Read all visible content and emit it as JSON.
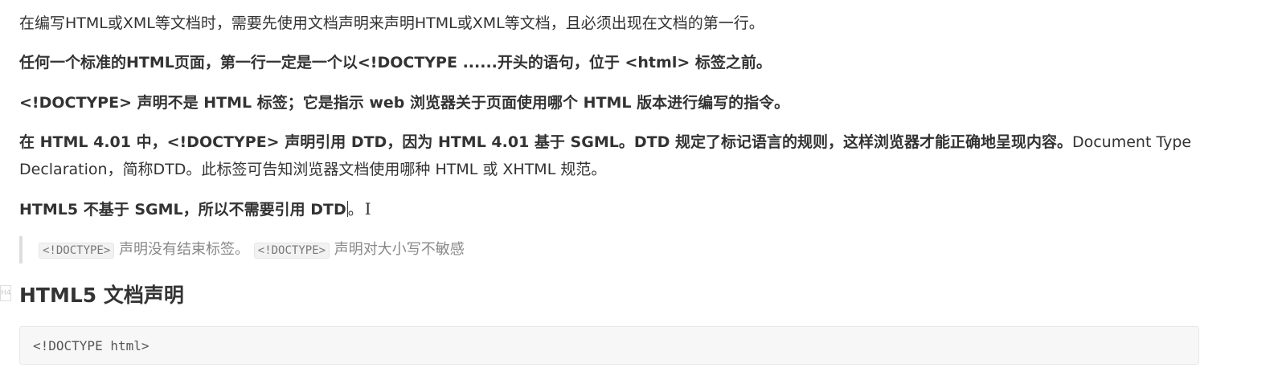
{
  "paragraphs": {
    "p1": "在编写HTML或XML等文档时，需要先使用文档声明来声明HTML或XML等文档，且必须出现在文档的第一行。",
    "p2": "任何一个标准的HTML页面，第一行一定是一个以<!DOCTYPE ......开头的语句，位于 <html> 标签之前。",
    "p3": "<!DOCTYPE> 声明不是 HTML 标签；它是指示 web 浏览器关于页面使用哪个 HTML 版本进行编写的指令。",
    "p4_bold": "在 HTML 4.01 中，<!DOCTYPE> 声明引用 DTD，因为 HTML 4.01 基于 SGML。DTD 规定了标记语言的规则，这样浏览器才能正确地呈现内容。",
    "p4_normal": "Document Type Declaration，简称DTD。此标签可告知浏览器文档使用哪种 HTML 或 XHTML 规范。",
    "p5_bold": "HTML5 不基于 SGML，所以不需要引用 DTD",
    "p5_end": "。"
  },
  "blockquote": {
    "code1": "<!DOCTYPE>",
    "text1": " 声明没有结束标签。",
    "code2": "<!DOCTYPE>",
    "text2": " 声明对大小写不敏感"
  },
  "heading": {
    "anchor": "H4",
    "text": "HTML5 文档声明"
  },
  "code_block": {
    "code": "<!DOCTYPE html>"
  },
  "cursor": {
    "icon": "text-cursor-icon",
    "glyph": "I"
  }
}
